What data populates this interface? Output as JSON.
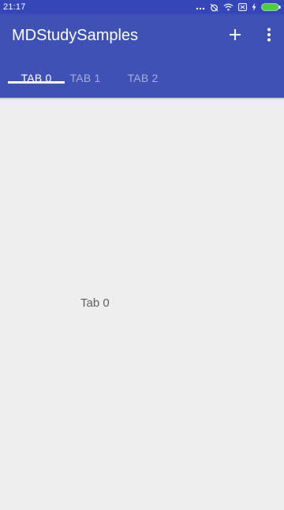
{
  "status_bar": {
    "time": "21:17",
    "icons": [
      "more-dots-icon",
      "alarm-off-icon",
      "wifi-icon",
      "sim-off-icon",
      "charging-icon",
      "battery-icon"
    ]
  },
  "app_bar": {
    "title": "MDStudySamples",
    "actions": [
      "add-icon",
      "more-vert-icon"
    ],
    "color": "#3f51b5"
  },
  "tabs": {
    "items": [
      {
        "label": "TAB 0",
        "selected": true
      },
      {
        "label": "TAB 1",
        "selected": false
      },
      {
        "label": "TAB 2",
        "selected": false
      }
    ]
  },
  "content": {
    "text": "Tab 0"
  },
  "colors": {
    "primary": "#3f51b5",
    "status_bar": "#3446b8",
    "background": "#eeeeef",
    "battery": "#4cd137"
  }
}
